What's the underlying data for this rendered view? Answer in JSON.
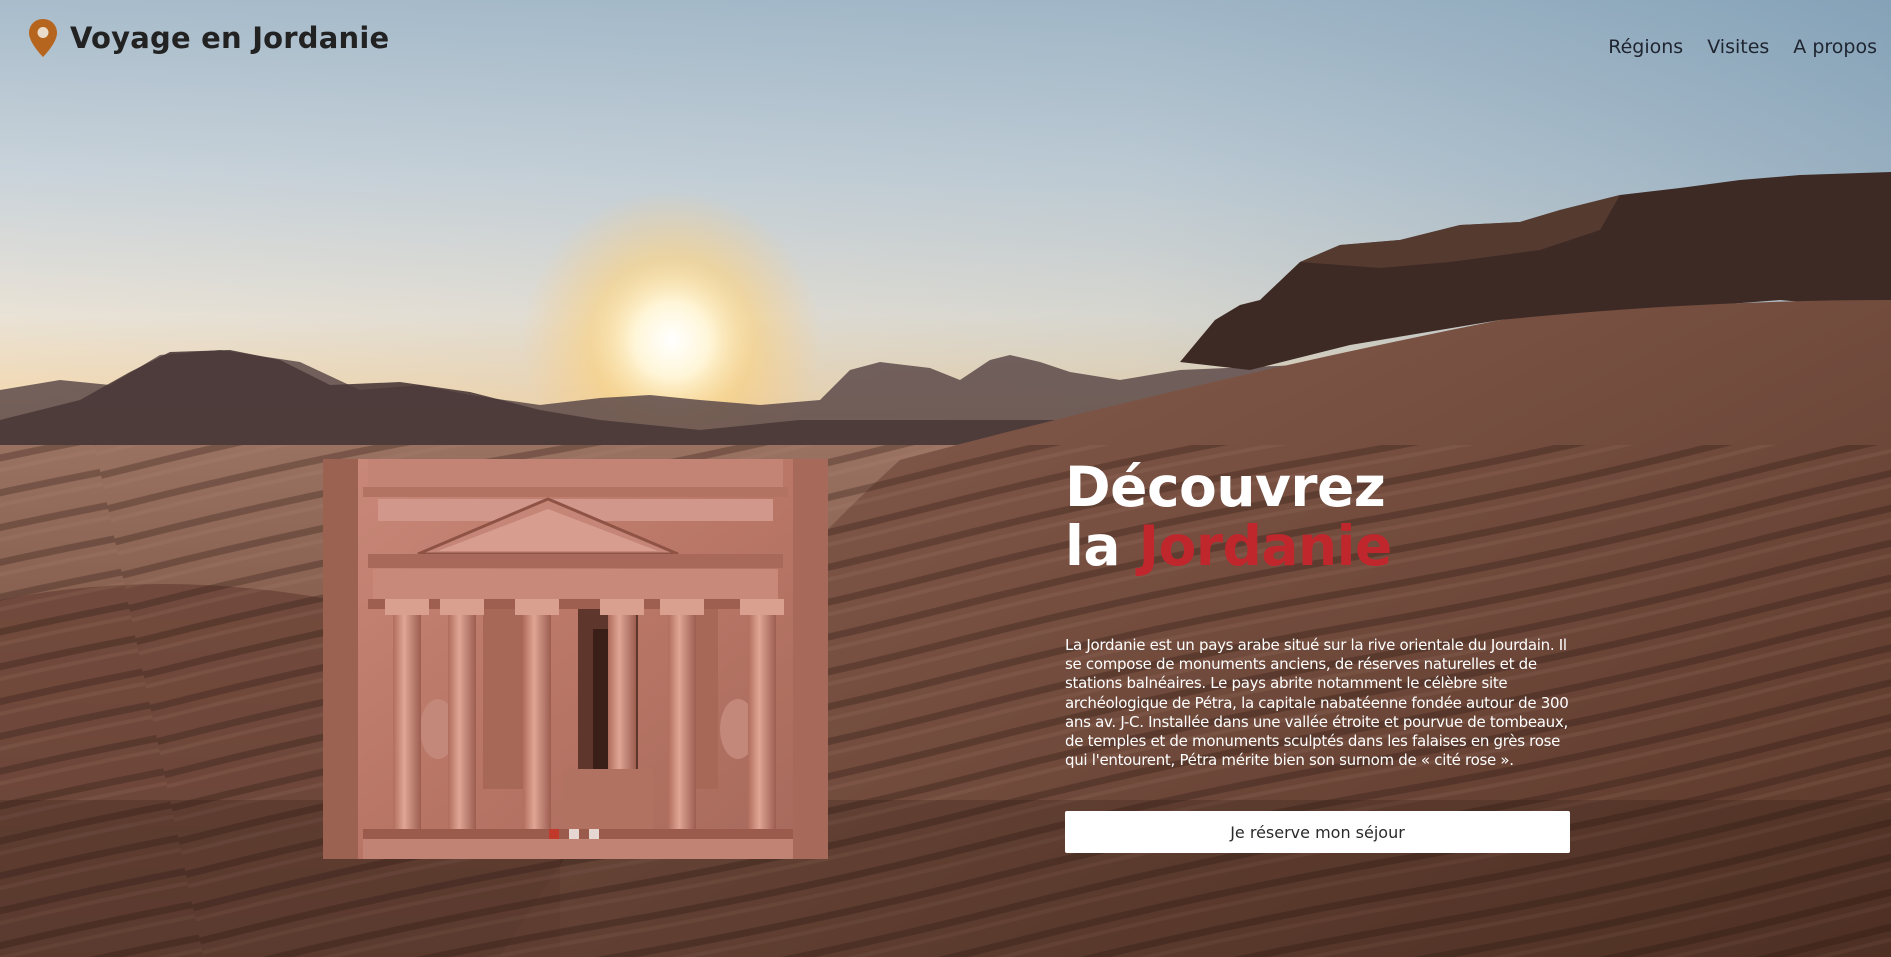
{
  "header": {
    "brand_title": "Voyage en Jordanie",
    "brand_icon": "map-pin-icon",
    "brand_icon_color": "#b5651d",
    "nav": [
      "Régions",
      "Visites",
      "A propos"
    ]
  },
  "hero": {
    "headline_line1": "Découvrez",
    "headline_line2_prefix": "la",
    "headline_line2_accent": "Jordanie",
    "accent_color": "#c0272d",
    "intro": "La Jordanie est un pays arabe situé sur la rive orientale du Jourdain. Il se compose de monuments anciens, de réserves naturelles et de stations balnéaires. Le pays abrite notamment le célèbre site archéologique de Pétra, la capitale nabatéenne fondée autour de 300 ans av. J-C. Installée dans une vallée étroite et pourvue de tombeaux, de temples et de monuments sculptés dans les falaises en grès rose qui l'entourent, Pétra mérite bien son surnom de « cité rose ».",
    "cta_label": "Je réserve mon séjour"
  },
  "carousel": {
    "slide_count": 3,
    "active_index": 0,
    "active_dot_color": "#c0392b"
  }
}
